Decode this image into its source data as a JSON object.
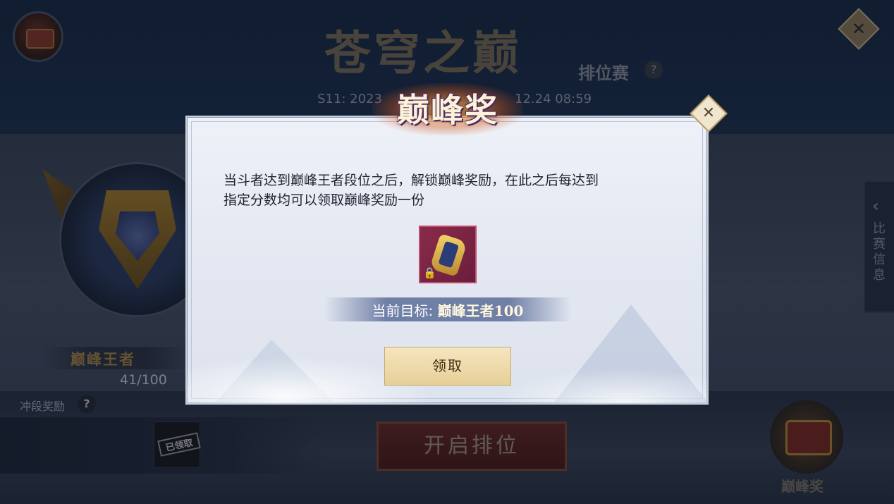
{
  "background": {
    "season_title": "苍穹之巅",
    "rank_label": "排位赛",
    "rank_help": "?",
    "season_time_left": "S11: 2023",
    "season_time_right": "12.24 08:59",
    "close_glyph": "✕",
    "tier_name": "巅峰王者",
    "tier_progress": "41/100",
    "promo_label": "冲段奖励",
    "promo_help": "?",
    "claimed_stamp": "已领取",
    "start_rank_label": "开启排位",
    "match_info_chevron": "‹",
    "match_info_label": "比赛信息",
    "peak_reward_label": "巅峰奖"
  },
  "modal": {
    "banner_title": "巅峰奖",
    "close_glyph": "✕",
    "description_line1": "当斗者达到巅峰王者段位之后，解锁巅峰奖励，在此之后每达到",
    "description_line2": "指定分数均可以领取巅峰奖励一份",
    "lock_glyph": "🔒",
    "target_label": "当前目标: ",
    "target_value": "巅峰王者100",
    "claim_button_label": "领取"
  },
  "icons": {
    "reward": "scroll-reward-icon",
    "lock": "lock-icon",
    "chest": "treasure-chest-icon"
  }
}
